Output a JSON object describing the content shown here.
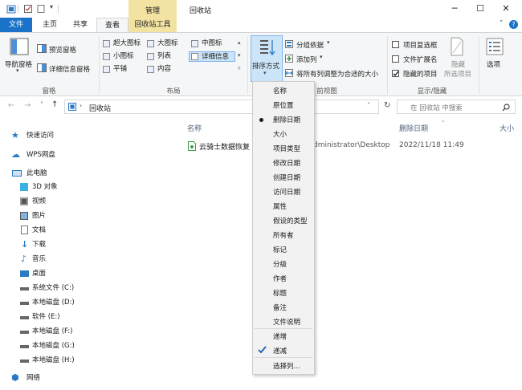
{
  "titlebar": {
    "manage_tab": "管理",
    "title": "回收站",
    "minimize": "─",
    "maximize": "☐",
    "close": "✕"
  },
  "tabs": [
    {
      "label": "文件"
    },
    {
      "label": "主页"
    },
    {
      "label": "共享"
    },
    {
      "label": "查看"
    },
    {
      "label": "回收站工具"
    }
  ],
  "ribbon": {
    "panes": {
      "nav_pane": "导航窗格",
      "preview_pane": "预览窗格",
      "details_pane": "详细信息窗格",
      "group_label": "窗格"
    },
    "layout": {
      "options": [
        "超大图标",
        "大图标",
        "中图标",
        "小图标",
        "列表",
        "详细信息",
        "平铺",
        "内容"
      ],
      "group_label": "布局"
    },
    "current_view": {
      "sort_by": "排序方式",
      "group_by": "分组依据",
      "add_columns": "添加列",
      "size_columns": "将所有列调整为合适的大小",
      "group_label": "当前视图",
      "group_label_visible": "前视图"
    },
    "show_hide": {
      "item_checkboxes": "项目复选框",
      "file_extensions": "文件扩展名",
      "hidden_items": "隐藏的项目",
      "hide_selected_1": "隐藏",
      "hide_selected_2": "所选项目",
      "group_label": "显示/隐藏"
    },
    "options": "选项"
  },
  "address": {
    "path": "回收站",
    "search_placeholder": "在 回收站 中搜索"
  },
  "nav": {
    "items": [
      {
        "label": "快速访问",
        "icon": "star-icon"
      },
      {
        "label": "WPS网盘",
        "icon": "cloud-icon"
      },
      {
        "label": "此电脑",
        "icon": "computer-icon"
      },
      {
        "label": "3D 对象",
        "icon": "cube-icon"
      },
      {
        "label": "视频",
        "icon": "video-icon"
      },
      {
        "label": "图片",
        "icon": "picture-icon"
      },
      {
        "label": "文档",
        "icon": "document-icon"
      },
      {
        "label": "下载",
        "icon": "download-icon"
      },
      {
        "label": "音乐",
        "icon": "music-icon"
      },
      {
        "label": "桌面",
        "icon": "desktop-icon"
      },
      {
        "label": "系统文件 (C:)",
        "icon": "drive-icon"
      },
      {
        "label": "本地磁盘 (D:)",
        "icon": "drive-icon"
      },
      {
        "label": "软件 (E:)",
        "icon": "drive-icon"
      },
      {
        "label": "本地磁盘 (F:)",
        "icon": "drive-icon"
      },
      {
        "label": "本地磁盘 (G:)",
        "icon": "drive-icon"
      },
      {
        "label": "本地磁盘 (H:)",
        "icon": "drive-icon"
      },
      {
        "label": "网络",
        "icon": "network-icon"
      }
    ]
  },
  "filelist": {
    "headers": [
      "名称",
      "删除日期",
      "大小"
    ],
    "rows": [
      {
        "name": "云骑士数据恢复",
        "location": "Administrator\\Desktop",
        "deleted": "2022/11/18 11:49"
      }
    ]
  },
  "sort_menu": {
    "fields": [
      "名称",
      "原位置",
      "删除日期",
      "大小",
      "项目类型",
      "修改日期",
      "创建日期",
      "访问日期",
      "属性",
      "假设的类型",
      "所有者",
      "标记",
      "分级",
      "作者",
      "标题",
      "备注",
      "文件说明"
    ],
    "selected_field": "删除日期",
    "orders": [
      "递增",
      "递减"
    ],
    "selected_order": "递减",
    "choose_columns": "选择列..."
  },
  "colors": {
    "accent": "#1a73c8",
    "manage_tab": "#f3e3a3",
    "selected_bg": "#cce4f7"
  }
}
